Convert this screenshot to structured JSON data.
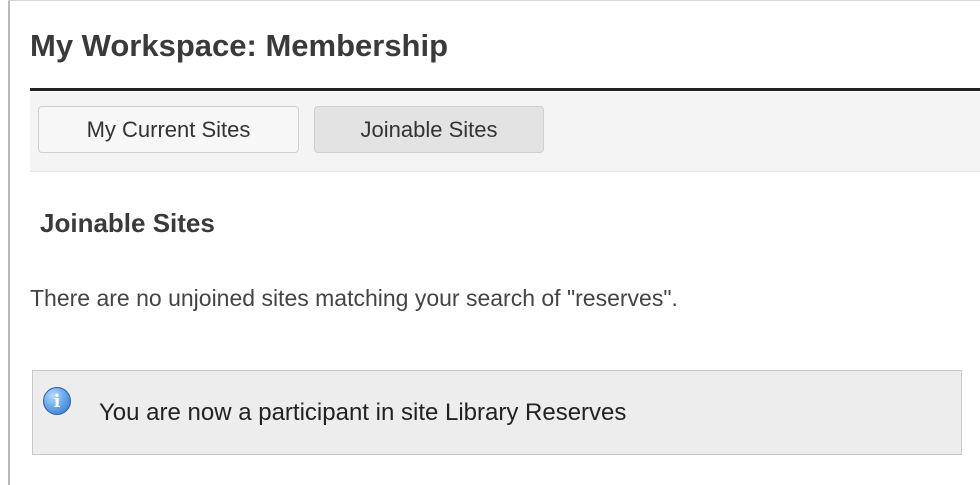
{
  "page": {
    "title": "My Workspace: Membership"
  },
  "tabs": [
    {
      "label": "My Current Sites",
      "active": false
    },
    {
      "label": "Joinable Sites",
      "active": true
    }
  ],
  "section": {
    "heading": "Joinable Sites",
    "message": "There are no unjoined sites matching your search of \"reserves\"."
  },
  "notice": {
    "icon": "info-icon",
    "text": "You are now a participant in site Library Reserves"
  },
  "colors": {
    "info_icon": "#2f6fc4",
    "notice_background": "#ededed",
    "title_underline": "#222222"
  }
}
